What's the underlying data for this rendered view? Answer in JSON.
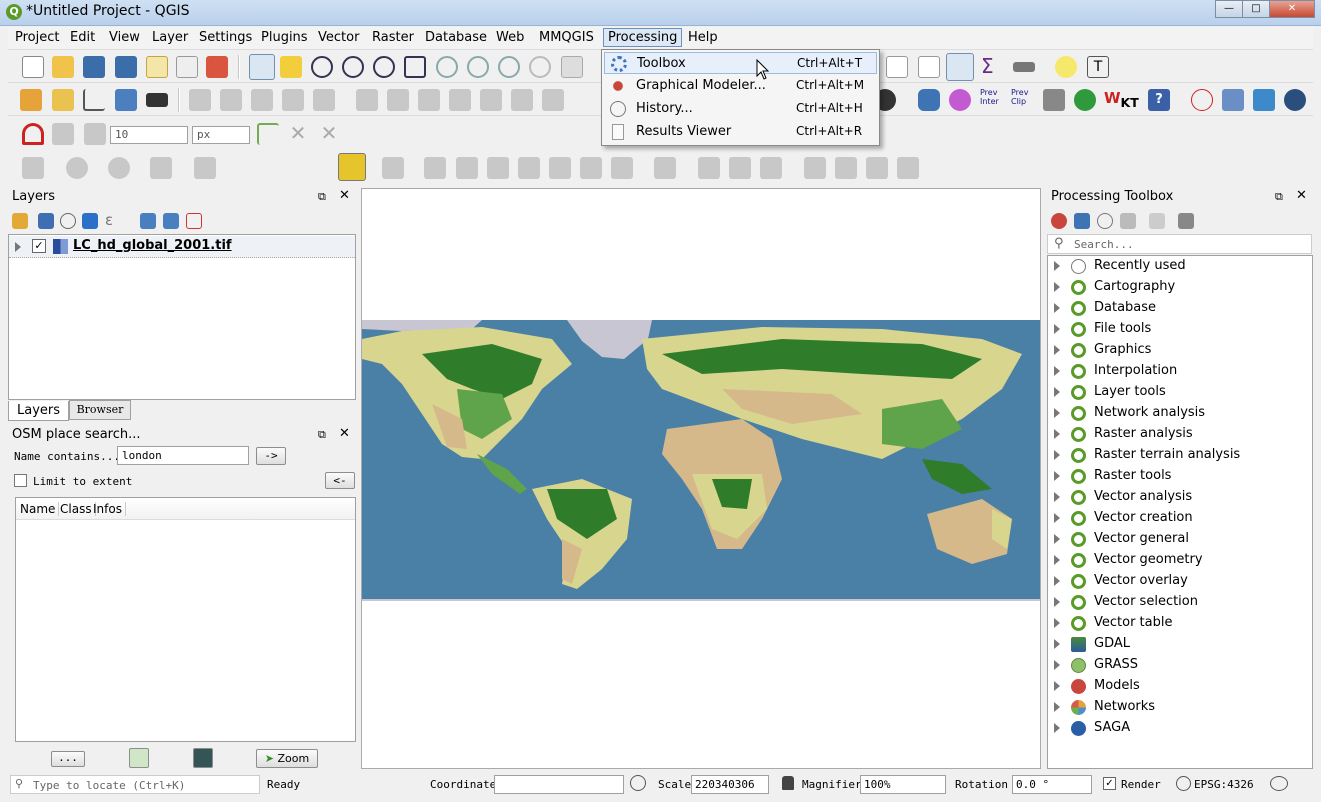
{
  "window": {
    "title": "*Untitled Project - QGIS"
  },
  "menubar": {
    "items": [
      "Project",
      "Edit",
      "View",
      "Layer",
      "Settings",
      "Plugins",
      "Vector",
      "Raster",
      "Database",
      "Web",
      "MMQGIS",
      "Processing",
      "Help"
    ]
  },
  "processing_menu": {
    "items": [
      {
        "label": "Toolbox",
        "shortcut": "Ctrl+Alt+T"
      },
      {
        "label": "Graphical Modeler...",
        "shortcut": "Ctrl+Alt+M"
      },
      {
        "label": "History...",
        "shortcut": "Ctrl+Alt+H"
      },
      {
        "label": "Results Viewer",
        "shortcut": "Ctrl+Alt+R"
      }
    ]
  },
  "digitize": {
    "size_value": "10",
    "unit_value": "px"
  },
  "toolbar_labels": {
    "prev_inter": "Prev\nInter",
    "prev_clip": "Prev\nClip"
  },
  "layers_panel": {
    "title": "Layers",
    "layers": [
      {
        "name": "LC_hd_global_2001.tif",
        "checked": true
      }
    ],
    "tabs": [
      "Layers",
      "Browser"
    ]
  },
  "osm_panel": {
    "title": "OSM place search...",
    "name_label": "Name contains...",
    "name_value": "london",
    "go_button": "->",
    "limit_label": "Limit to extent",
    "back_button": "<-",
    "columns": [
      "Name",
      "Class",
      "Infos"
    ],
    "more_button": "...",
    "zoom_button": "Zoom"
  },
  "toolbox_panel": {
    "title": "Processing Toolbox",
    "search_placeholder": "Search...",
    "groups": [
      {
        "label": "Recently used",
        "icon": "clock-icon"
      },
      {
        "label": "Cartography",
        "icon": "qgis-icon"
      },
      {
        "label": "Database",
        "icon": "qgis-icon"
      },
      {
        "label": "File tools",
        "icon": "qgis-icon"
      },
      {
        "label": "Graphics",
        "icon": "qgis-icon"
      },
      {
        "label": "Interpolation",
        "icon": "qgis-icon"
      },
      {
        "label": "Layer tools",
        "icon": "qgis-icon"
      },
      {
        "label": "Network analysis",
        "icon": "qgis-icon"
      },
      {
        "label": "Raster analysis",
        "icon": "qgis-icon"
      },
      {
        "label": "Raster terrain analysis",
        "icon": "qgis-icon"
      },
      {
        "label": "Raster tools",
        "icon": "qgis-icon"
      },
      {
        "label": "Vector analysis",
        "icon": "qgis-icon"
      },
      {
        "label": "Vector creation",
        "icon": "qgis-icon"
      },
      {
        "label": "Vector general",
        "icon": "qgis-icon"
      },
      {
        "label": "Vector geometry",
        "icon": "qgis-icon"
      },
      {
        "label": "Vector overlay",
        "icon": "qgis-icon"
      },
      {
        "label": "Vector selection",
        "icon": "qgis-icon"
      },
      {
        "label": "Vector table",
        "icon": "qgis-icon"
      },
      {
        "label": "GDAL",
        "icon": "gdal-icon"
      },
      {
        "label": "GRASS",
        "icon": "grass-icon"
      },
      {
        "label": "Models",
        "icon": "models-icon"
      },
      {
        "label": "Networks",
        "icon": "networks-icon"
      },
      {
        "label": "SAGA",
        "icon": "saga-icon"
      }
    ]
  },
  "statusbar": {
    "locate_placeholder": "Type to locate (Ctrl+K)",
    "status": "Ready",
    "coordinate_label": "Coordinate",
    "coordinate_value": "",
    "scale_label": "Scale",
    "scale_value": "220340306",
    "magnifier_label": "Magnifier",
    "magnifier_value": "100%",
    "rotation_label": "Rotation",
    "rotation_value": "0.0 °",
    "render_label": "Render",
    "crs": "EPSG:4326"
  },
  "colors": {
    "ocean": "#4a7fa6",
    "forest": "#2f7d2a",
    "grass": "#d8d68e",
    "desert": "#d6b98a",
    "ice": "#c8c6d3"
  }
}
